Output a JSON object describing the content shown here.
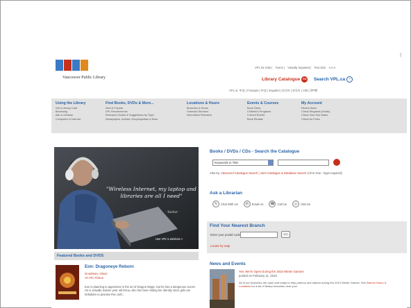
{
  "brand": {
    "name": "Vancouver Public Library",
    "logo_colors": [
      "#3a79c6",
      "#c5311c",
      "#3a79c6",
      "#e08a1e"
    ]
  },
  "header": {
    "toplinks": [
      "VPL for Kids",
      "Teens",
      "Visually Impaired",
      "Text Size"
    ],
    "text_size_glyphs": "A A A",
    "catalogue_label": "Library Catalogue",
    "catalogue_go": "GO",
    "search_label": "Search VPL.ca",
    "languages": "VPL in: 中文 | Français | 中文 | Español | 한국어 | 한국어 | Việt | ਪੰਜਾਬੀ"
  },
  "nav": [
    {
      "heading": "Using the Library",
      "items": [
        "Get a Library Card",
        "Borrowing",
        "Ask a Librarian",
        "Computers & Internet"
      ]
    },
    {
      "heading": "Find Books, DVDs & More...",
      "items": [
        "New & Popular",
        "VPL Recommends",
        "Research Guides & Suggestions by Topic",
        "Newspapers, Articles, Encyclopedias & More"
      ]
    },
    {
      "heading": "Locations & Hours",
      "items": [
        "Branches & Hours",
        "Outreach Services",
        "Information Research"
      ]
    },
    {
      "heading": "Events & Courses",
      "items": [
        "Book Clubs",
        "Children's Programs",
        "Current Events",
        "Book Rentals"
      ]
    },
    {
      "heading": "My Account",
      "items": [
        "Renew Items",
        "Check Requests (Holds)",
        "Check Your Due Dates",
        "Check for Fines"
      ]
    }
  ],
  "hero": {
    "quote": "\"Wireless Internet, my laptop and libraries are all I need\"",
    "signature": "- Yashar",
    "caption": "Use VPL's wireless >"
  },
  "catalogue_search": {
    "title": "Books / DVDs / CDs - Search the Catalogue",
    "select_value": "Keywords in Title",
    "also_try_prefix": "Also try:",
    "also_try_links": "Advanced Catalogue Search | Joint Catalogue & Database Search",
    "also_try_suffix": "(All In One - login required)"
  },
  "ask": {
    "title": "Ask a Librarian",
    "items": [
      {
        "label": "Chat With Us",
        "icon": "chat-icon"
      },
      {
        "label": "Email Us",
        "icon": "email-icon"
      },
      {
        "label": "Call Us",
        "icon": "phone-icon"
      },
      {
        "label": "Visit Us",
        "icon": "visit-icon"
      }
    ]
  },
  "branch": {
    "title": "Find Your Nearest Branch",
    "postal_label": "Enter your postal code:",
    "go_label": "GO",
    "locate_label": "Locate by map"
  },
  "news": {
    "title": "News and Events",
    "headline": "Yes, We're Open During the 2010 Winter Games!",
    "date": "posted on February 11, 2010",
    "body_prefix": "All of our branches are open and ready to help patrons and visitors during the 2010 Winter Games. See",
    "body_link": "Branch Hours & Locations",
    "body_suffix": "for a list of library branches near you!"
  },
  "featured": {
    "title": "Featured Books and DVDS",
    "book_title": "Eon: Dragoneye Reborn",
    "author": "Goodman, Alison",
    "category": "YA FIC Fiction",
    "body": "Eon is planning to apprentice in the art of Dragon Magic, but he has a dangerous secret. He is actually sixteen year old Eona, who has been hiding her identity since girls are forbidden to practise this craft..."
  }
}
